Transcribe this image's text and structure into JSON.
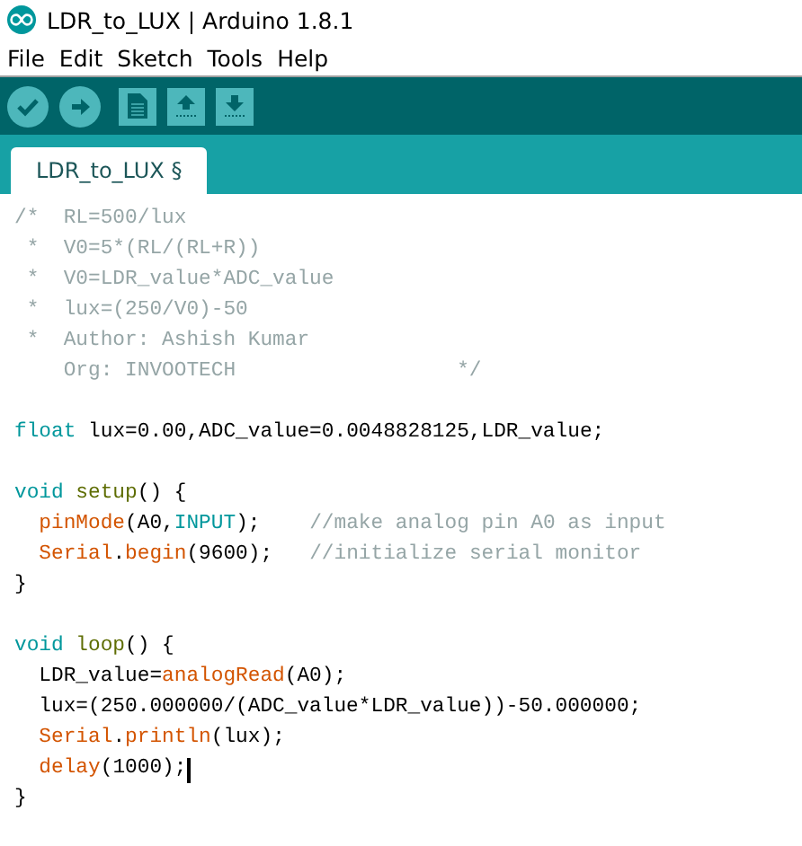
{
  "window": {
    "title": "LDR_to_LUX | Arduino 1.8.1"
  },
  "menu": [
    "File",
    "Edit",
    "Sketch",
    "Tools",
    "Help"
  ],
  "toolbar": [
    {
      "kind": "verify"
    },
    {
      "kind": "upload"
    },
    {
      "kind": "new"
    },
    {
      "kind": "open"
    },
    {
      "kind": "save"
    }
  ],
  "tabs": [
    {
      "label": "LDR_to_LUX §",
      "selected": true
    }
  ],
  "editor": {
    "lines": [
      {
        "kind": "code",
        "tokens": [
          {
            "kind": "comment",
            "text": "/*  RL=500/lux"
          }
        ]
      },
      {
        "kind": "code",
        "tokens": [
          {
            "kind": "comment",
            "text": " *  V0=5*(RL/(RL+R))"
          }
        ]
      },
      {
        "kind": "code",
        "tokens": [
          {
            "kind": "comment",
            "text": " *  V0=LDR_value*ADC_value"
          }
        ]
      },
      {
        "kind": "code",
        "tokens": [
          {
            "kind": "comment",
            "text": " *  lux=(250/V0)-50"
          }
        ]
      },
      {
        "kind": "code",
        "tokens": [
          {
            "kind": "comment",
            "text": " *  Author: Ashish Kumar"
          }
        ]
      },
      {
        "kind": "code",
        "tokens": [
          {
            "kind": "comment",
            "text": "    Org: INVOOTECH                  */"
          }
        ]
      },
      {
        "kind": "blank"
      },
      {
        "kind": "code",
        "tokens": [
          {
            "kind": "type",
            "text": "float"
          },
          {
            "kind": "plain",
            "text": " lux=0.00,ADC_value=0.0048828125,LDR_value;"
          }
        ]
      },
      {
        "kind": "blank"
      },
      {
        "kind": "code",
        "tokens": [
          {
            "kind": "type",
            "text": "void"
          },
          {
            "kind": "structure",
            "text": " setup"
          },
          {
            "kind": "plain",
            "text": "() {"
          }
        ]
      },
      {
        "kind": "code",
        "tokens": [
          {
            "kind": "function",
            "text": "  pinMode"
          },
          {
            "kind": "plain",
            "text": "(A0,"
          },
          {
            "kind": "type",
            "text": "INPUT"
          },
          {
            "kind": "plain",
            "text": ");    "
          },
          {
            "kind": "comment",
            "text": "//make analog pin A0 as input"
          }
        ]
      },
      {
        "kind": "code",
        "tokens": [
          {
            "kind": "function",
            "text": "  Serial"
          },
          {
            "kind": "plain",
            "text": "."
          },
          {
            "kind": "function",
            "text": "begin"
          },
          {
            "kind": "plain",
            "text": "(9600);   "
          },
          {
            "kind": "comment",
            "text": "//initialize serial monitor"
          }
        ]
      },
      {
        "kind": "code",
        "tokens": [
          {
            "kind": "plain",
            "text": "}"
          }
        ]
      },
      {
        "kind": "blank"
      },
      {
        "kind": "code",
        "tokens": [
          {
            "kind": "type",
            "text": "void"
          },
          {
            "kind": "structure",
            "text": " loop"
          },
          {
            "kind": "plain",
            "text": "() {"
          }
        ]
      },
      {
        "kind": "code",
        "tokens": [
          {
            "kind": "plain",
            "text": "  LDR_value="
          },
          {
            "kind": "function",
            "text": "analogRead"
          },
          {
            "kind": "plain",
            "text": "(A0);"
          }
        ]
      },
      {
        "kind": "code",
        "tokens": [
          {
            "kind": "plain",
            "text": "  lux=(250.000000/(ADC_value*LDR_value))-50.000000;"
          }
        ]
      },
      {
        "kind": "code",
        "tokens": [
          {
            "kind": "function",
            "text": "  Serial"
          },
          {
            "kind": "plain",
            "text": "."
          },
          {
            "kind": "function",
            "text": "println"
          },
          {
            "kind": "plain",
            "text": "(lux);"
          }
        ]
      },
      {
        "kind": "code",
        "cursor": true,
        "tokens": [
          {
            "kind": "function",
            "text": "  delay"
          },
          {
            "kind": "plain",
            "text": "(1000);"
          }
        ]
      },
      {
        "kind": "code",
        "tokens": [
          {
            "kind": "plain",
            "text": "}"
          }
        ]
      }
    ]
  }
}
